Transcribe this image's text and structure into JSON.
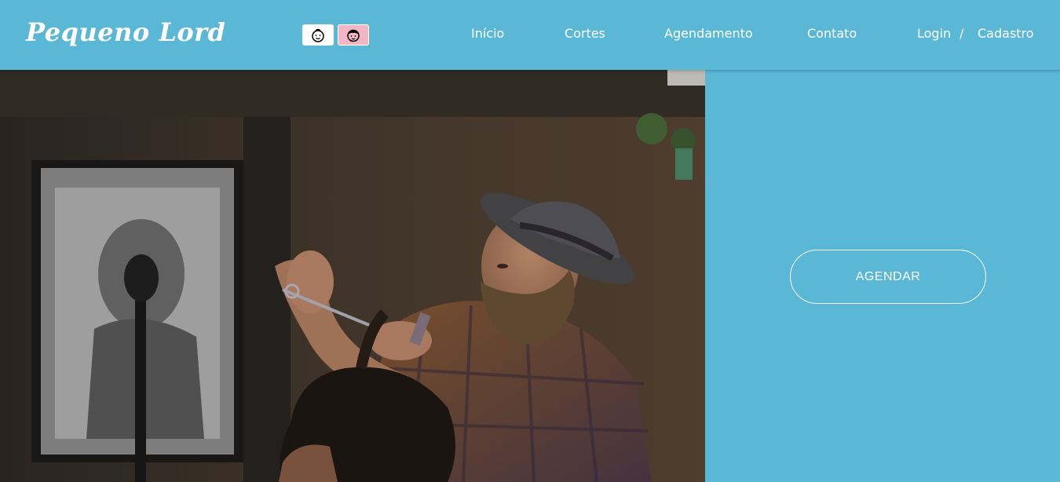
{
  "brand": {
    "name": "Pequeno Lord"
  },
  "theme_toggles": [
    {
      "icon": "child-face-icon",
      "color": "#ffffff"
    },
    {
      "icon": "girl-face-icon",
      "color": "#f3b6c6"
    }
  ],
  "nav": {
    "inicio": "Início",
    "cortes": "Cortes",
    "agendamento": "Agendamento",
    "contato": "Contato",
    "login": "Login",
    "separator": "/",
    "cadastro": "Cadastro"
  },
  "hero": {
    "cta_label": "AGENDAR"
  },
  "colors": {
    "primary": "#5ab8d6",
    "pink": "#f3b6c6",
    "white": "#ffffff"
  }
}
